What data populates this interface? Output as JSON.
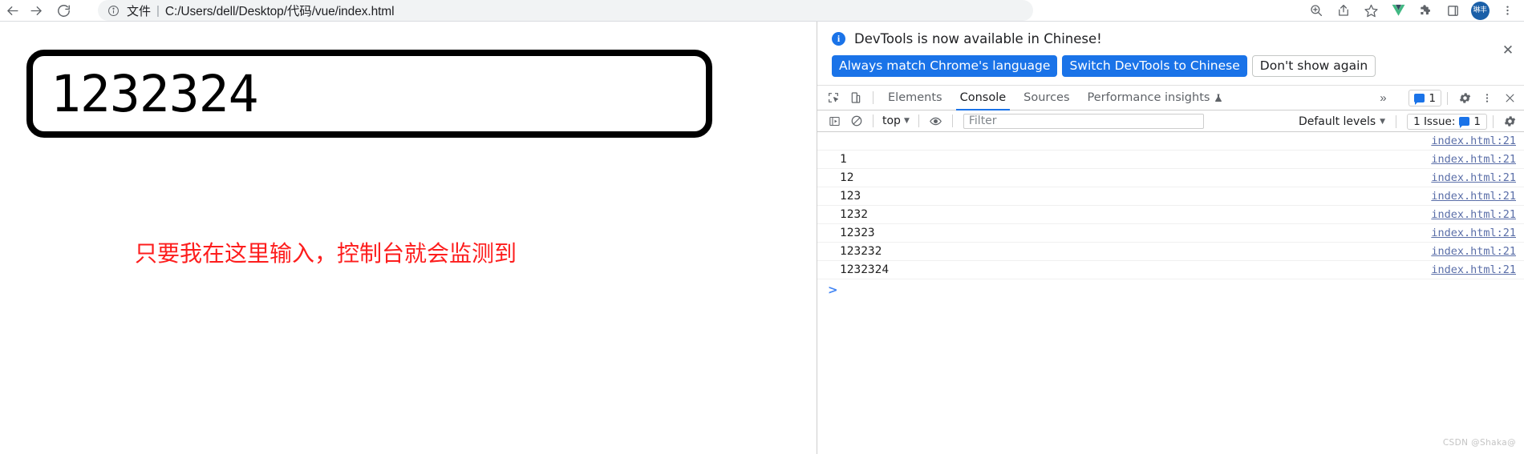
{
  "browser": {
    "nav": {
      "back_label": "Back",
      "forward_label": "Forward",
      "reload_label": "Reload"
    },
    "omnibox": {
      "site_info_icon": "info-circle-icon",
      "file_label": "文件",
      "separator": "|",
      "url": "C:/Users/dell/Desktop/代码/vue/index.html"
    },
    "actions": [
      {
        "name": "zoom-icon",
        "label": "Zoom"
      },
      {
        "name": "share-icon",
        "label": "Share this page"
      },
      {
        "name": "bookmark-star-icon",
        "label": "Bookmark this tab"
      },
      {
        "name": "vue-devtools-icon",
        "label": "Vue.js devtools"
      },
      {
        "name": "extensions-puzzle-icon",
        "label": "Extensions"
      },
      {
        "name": "side-panel-icon",
        "label": "Side panel"
      }
    ],
    "avatar": {
      "initials": "琳丰"
    },
    "menu_label": "Customize and control Google Chrome"
  },
  "page": {
    "input_value": "1232324",
    "hint_text": "只要我在这里输入，控制台就会监测到"
  },
  "devtools": {
    "banner": {
      "icon": "info-icon",
      "message": "DevTools is now available in Chinese!",
      "buttons": [
        {
          "label": "Always match Chrome's language",
          "style": "primary"
        },
        {
          "label": "Switch DevTools to Chinese",
          "style": "primary"
        },
        {
          "label": "Don't show again",
          "style": "secondary"
        }
      ],
      "close_label": "✕"
    },
    "tabstrip": {
      "left_icons": [
        {
          "name": "inspect-element-icon",
          "label": "Inspect element"
        },
        {
          "name": "device-toolbar-icon",
          "label": "Toggle device toolbar"
        }
      ],
      "tabs": [
        {
          "label": "Elements",
          "active": false,
          "badge": ""
        },
        {
          "label": "Console",
          "active": true,
          "badge": ""
        },
        {
          "label": "Sources",
          "active": false,
          "badge": ""
        },
        {
          "label": "Performance insights",
          "active": false,
          "badge": "experiment-flask-icon"
        }
      ],
      "more_tabs_label": "»",
      "issues_chip": {
        "icon": "message-badge-icon",
        "count": "1"
      },
      "settings_label": "Settings",
      "more_options_label": "⋮",
      "close_label": "✕"
    },
    "console_toolbar": {
      "sidebar_toggle_label": "Show console sidebar",
      "clear_console_label": "Clear console",
      "context": {
        "value": "top",
        "caret": "▼"
      },
      "live_expression_label": "Create live expression",
      "filter": {
        "value": "",
        "placeholder": "Filter"
      },
      "levels": {
        "value": "Default levels",
        "caret": "▼"
      },
      "issues": {
        "text": "1 Issue:",
        "icon": "message-badge-icon",
        "count": "1"
      },
      "settings_label": "Console settings"
    },
    "console_rows": [
      {
        "message": "",
        "source": "index.html:21"
      },
      {
        "message": "1",
        "source": "index.html:21"
      },
      {
        "message": "12",
        "source": "index.html:21"
      },
      {
        "message": "123",
        "source": "index.html:21"
      },
      {
        "message": "1232",
        "source": "index.html:21"
      },
      {
        "message": "12323",
        "source": "index.html:21"
      },
      {
        "message": "123232",
        "source": "index.html:21"
      },
      {
        "message": "1232324",
        "source": "index.html:21"
      }
    ],
    "prompt": {
      "caret": ">",
      "value": ""
    }
  },
  "watermark": "CSDN @Shaka@",
  "colors": {
    "accent_blue": "#1a73e8",
    "hint_red": "#fd1d1d",
    "link_blue": "#5a6ea8",
    "avatar_blue": "#1a5fa8"
  }
}
